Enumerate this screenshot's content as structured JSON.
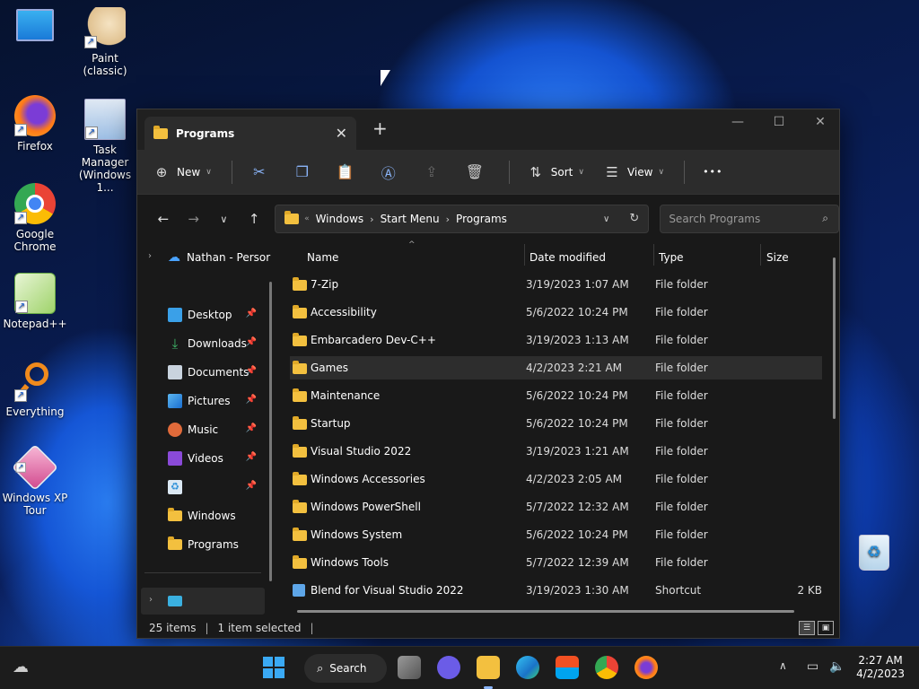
{
  "desktop": {
    "icons": [
      {
        "label": ""
      },
      {
        "label": "Paint (classic)"
      },
      {
        "label": "Firefox"
      },
      {
        "label": "Task Manager (Windows 1..."
      },
      {
        "label": "Google Chrome"
      },
      {
        "label": "Notepad++"
      },
      {
        "label": "Everything"
      },
      {
        "label": "Windows XP Tour"
      },
      {
        "label": ""
      }
    ]
  },
  "window": {
    "tab_title": "Programs",
    "tab_close": "✕",
    "new_tab": "+",
    "controls": {
      "minimize": "—",
      "maximize": "☐",
      "close": "✕"
    }
  },
  "commandbar": {
    "new_label": "New",
    "sort_label": "Sort",
    "view_label": "View",
    "more_label": "•••"
  },
  "address": {
    "crumbs": [
      "Windows",
      "Start Menu",
      "Programs"
    ],
    "search_placeholder": "Search Programs"
  },
  "sidebar": {
    "onedrive": "Nathan - Persor",
    "items": [
      {
        "label": "Desktop",
        "pinned": true
      },
      {
        "label": "Downloads",
        "pinned": true
      },
      {
        "label": "Documents",
        "pinned": true
      },
      {
        "label": "Pictures",
        "pinned": true
      },
      {
        "label": "Music",
        "pinned": true
      },
      {
        "label": "Videos",
        "pinned": true
      },
      {
        "label": "",
        "pinned": true
      },
      {
        "label": "Windows",
        "pinned": false
      },
      {
        "label": "Programs",
        "pinned": false
      }
    ]
  },
  "columns": {
    "name": "Name",
    "date": "Date modified",
    "type": "Type",
    "size": "Size"
  },
  "files": [
    {
      "name": "7-Zip",
      "date": "3/19/2023 1:07 AM",
      "type": "File folder",
      "size": ""
    },
    {
      "name": "Accessibility",
      "date": "5/6/2022 10:24 PM",
      "type": "File folder",
      "size": ""
    },
    {
      "name": "Embarcadero Dev-C++",
      "date": "3/19/2023 1:13 AM",
      "type": "File folder",
      "size": ""
    },
    {
      "name": "Games",
      "date": "4/2/2023 2:21 AM",
      "type": "File folder",
      "size": ""
    },
    {
      "name": "Maintenance",
      "date": "5/6/2022 10:24 PM",
      "type": "File folder",
      "size": ""
    },
    {
      "name": "Startup",
      "date": "5/6/2022 10:24 PM",
      "type": "File folder",
      "size": ""
    },
    {
      "name": "Visual Studio 2022",
      "date": "3/19/2023 1:21 AM",
      "type": "File folder",
      "size": ""
    },
    {
      "name": "Windows Accessories",
      "date": "4/2/2023 2:05 AM",
      "type": "File folder",
      "size": ""
    },
    {
      "name": "Windows PowerShell",
      "date": "5/7/2022 12:32 AM",
      "type": "File folder",
      "size": ""
    },
    {
      "name": "Windows System",
      "date": "5/6/2022 10:24 PM",
      "type": "File folder",
      "size": ""
    },
    {
      "name": "Windows Tools",
      "date": "5/7/2022 12:39 AM",
      "type": "File folder",
      "size": ""
    },
    {
      "name": "Blend for Visual Studio 2022",
      "date": "3/19/2023 1:30 AM",
      "type": "Shortcut",
      "size": "2 KB"
    }
  ],
  "selected_row": 3,
  "status": {
    "count": "25 items",
    "selection": "1 item selected"
  },
  "taskbar": {
    "search_label": "Search",
    "time": "2:27 AM",
    "date": "4/2/2023"
  },
  "colors": {
    "accent": "#8ab4f8",
    "folder": "#f3c03f"
  }
}
